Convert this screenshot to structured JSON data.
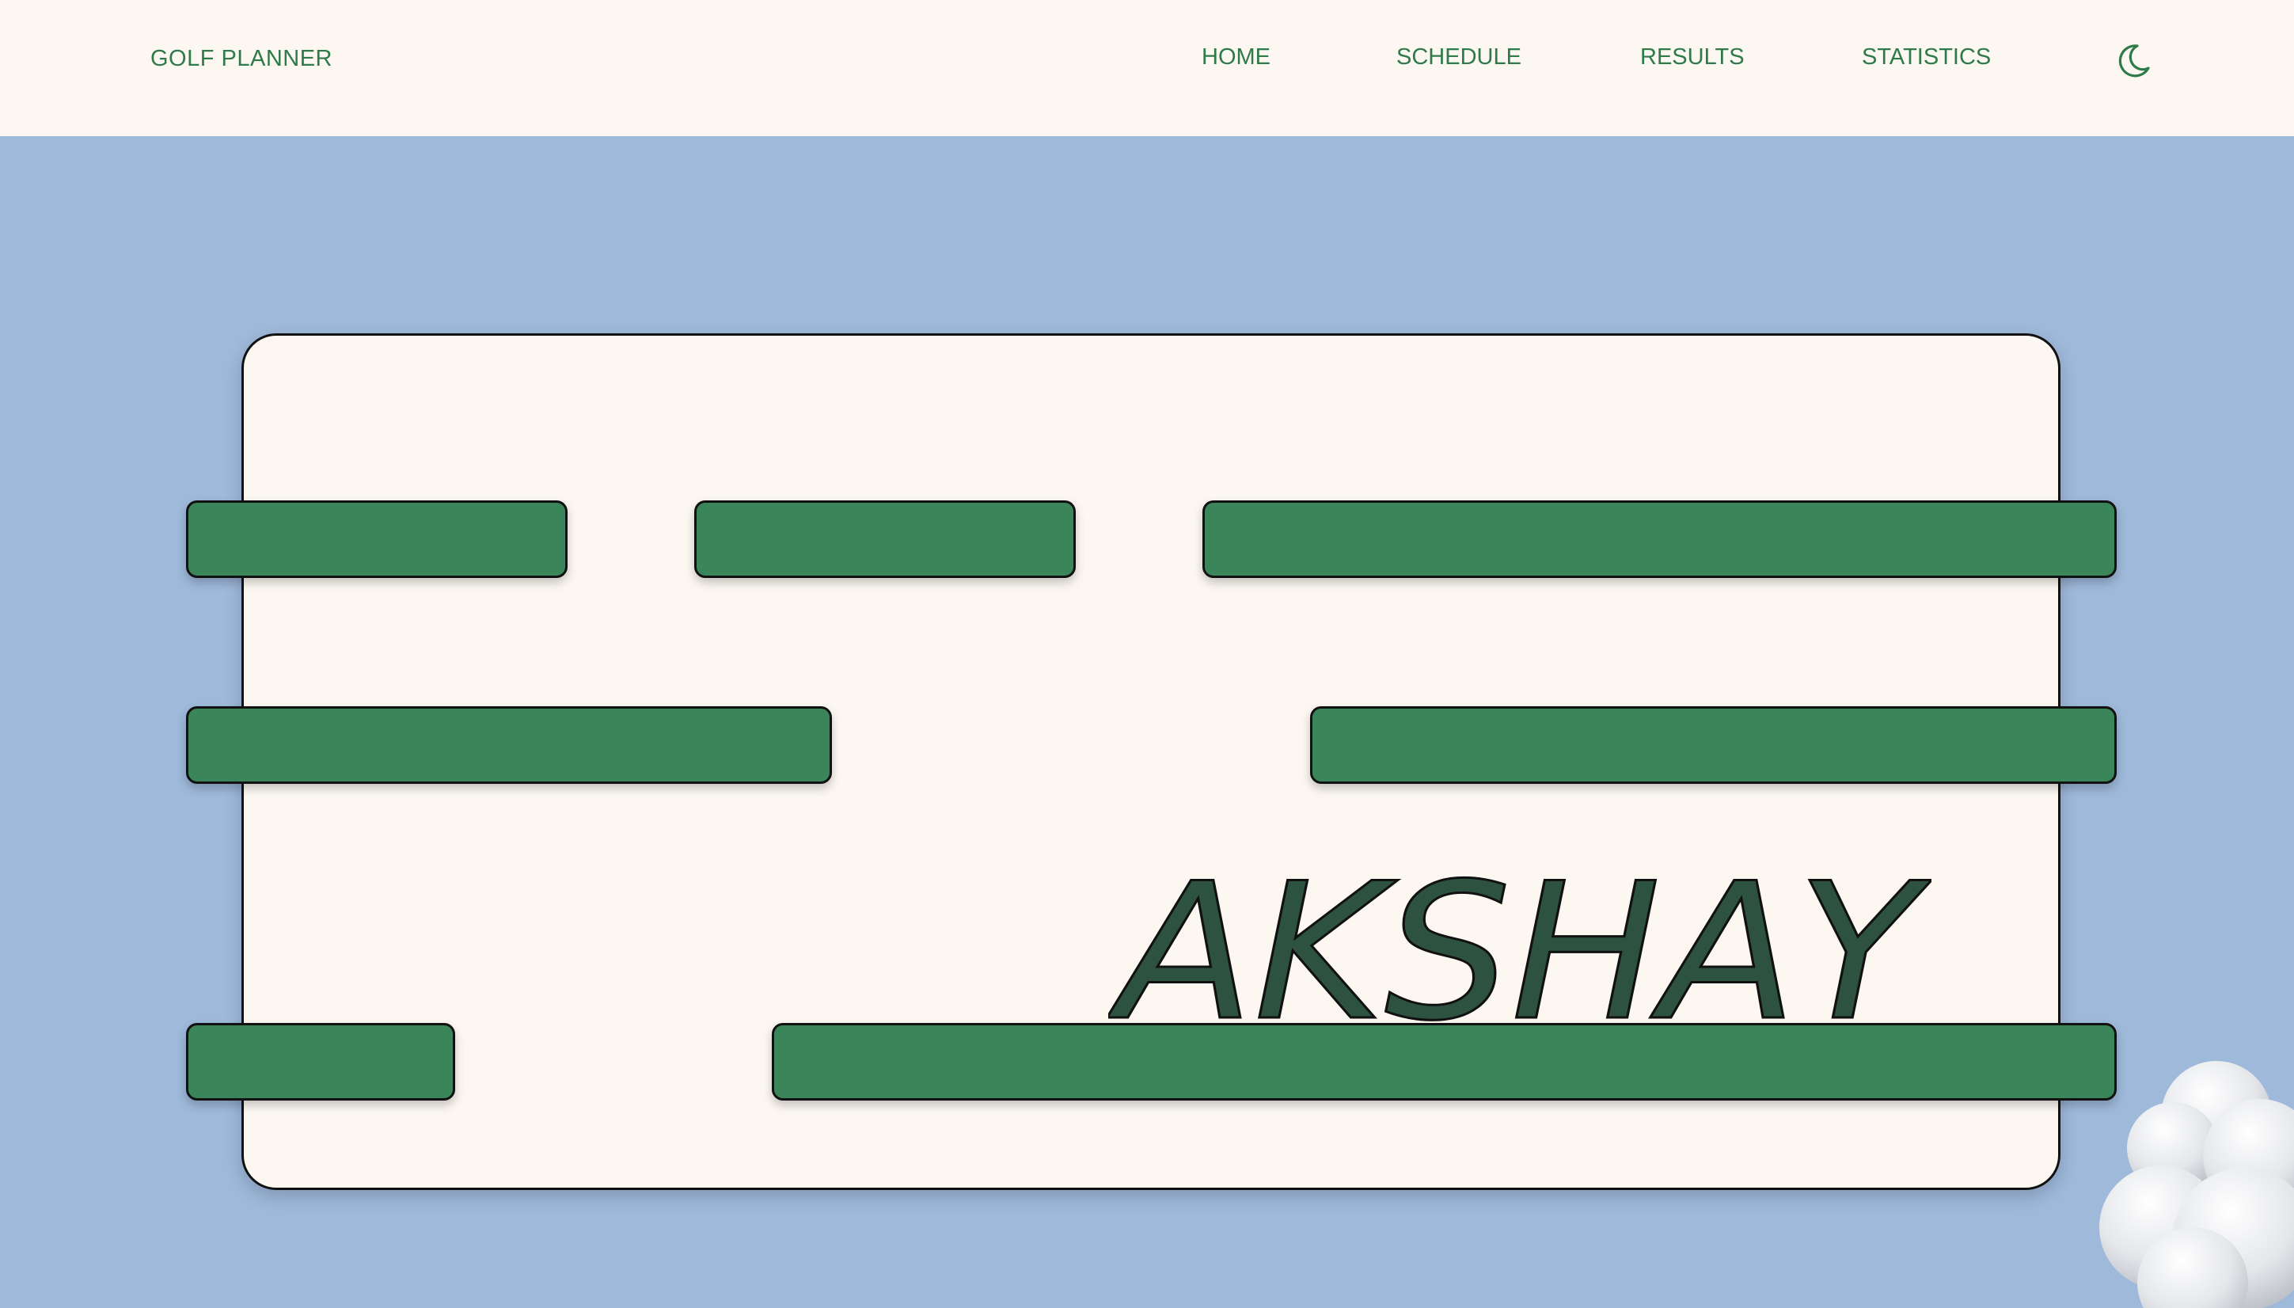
{
  "navbar": {
    "brand": "GOLF PLANNER",
    "links": [
      "HOME",
      "SCHEDULE",
      "RESULTS",
      "STATISTICS"
    ],
    "theme_toggle_icon": "moon-icon"
  },
  "hero": {
    "name": "AKSHAY",
    "decoration": "cloud-blob"
  },
  "colors": {
    "page_background": "#9fb9db",
    "surface": "#fcf7f1",
    "accent_green": "#2f7a49",
    "bar_green": "#3b855a",
    "name_fill": "#2e5240",
    "outline": "#111111"
  }
}
